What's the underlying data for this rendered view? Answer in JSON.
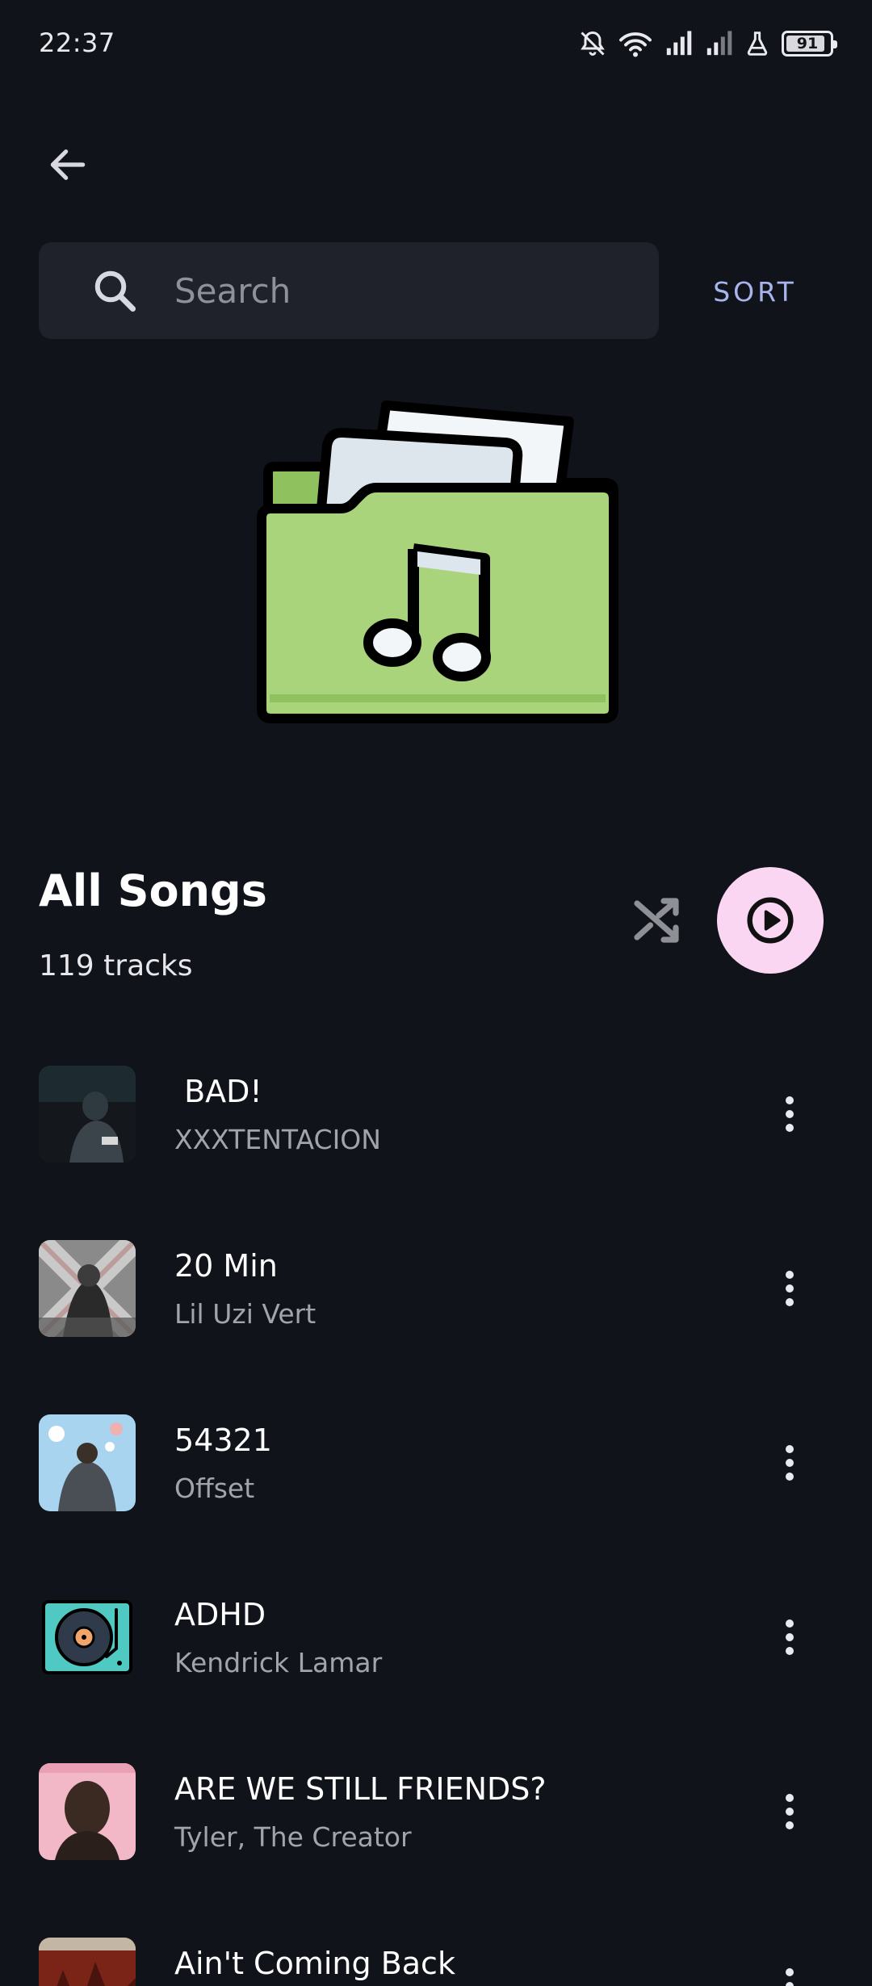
{
  "status_bar": {
    "time": "22:37",
    "battery_level": "91",
    "battery_fraction": 0.91,
    "icons": [
      "bell-off-icon",
      "wifi-icon",
      "signal-icon",
      "signal-icon",
      "flask-icon",
      "battery-icon"
    ]
  },
  "header": {
    "back_icon": "arrow-left-icon"
  },
  "search": {
    "placeholder": "Search",
    "value": "",
    "icon": "search-icon"
  },
  "sort_label": "SORT",
  "hero": {
    "icon": "music-folder-icon",
    "colors": {
      "folder": "#a9d47c",
      "folder_dark": "#8fc15e",
      "paper": "#dce6ec",
      "outline": "#000000"
    }
  },
  "playlist": {
    "title": "All Songs",
    "track_count": "119 tracks",
    "shuffle_icon": "shuffle-icon",
    "play_icon": "play-icon",
    "accent": "#fbd6f2"
  },
  "songs": [
    {
      "title": " BAD!",
      "artist": "XXXTENTACION",
      "art": "dark-photo-art"
    },
    {
      "title": "20 Min",
      "artist": "Lil Uzi Vert",
      "art": "grey-collage-art"
    },
    {
      "title": "54321",
      "artist": "Offset",
      "art": "sky-photo-art"
    },
    {
      "title": "ADHD",
      "artist": "Kendrick Lamar",
      "art": "turntable-art"
    },
    {
      "title": "ARE WE STILL FRIENDS?",
      "artist": "Tyler, The Creator",
      "art": "pink-portrait-art"
    },
    {
      "title": "Ain't Coming Back",
      "artist": "",
      "art": "red-cover-art"
    }
  ]
}
